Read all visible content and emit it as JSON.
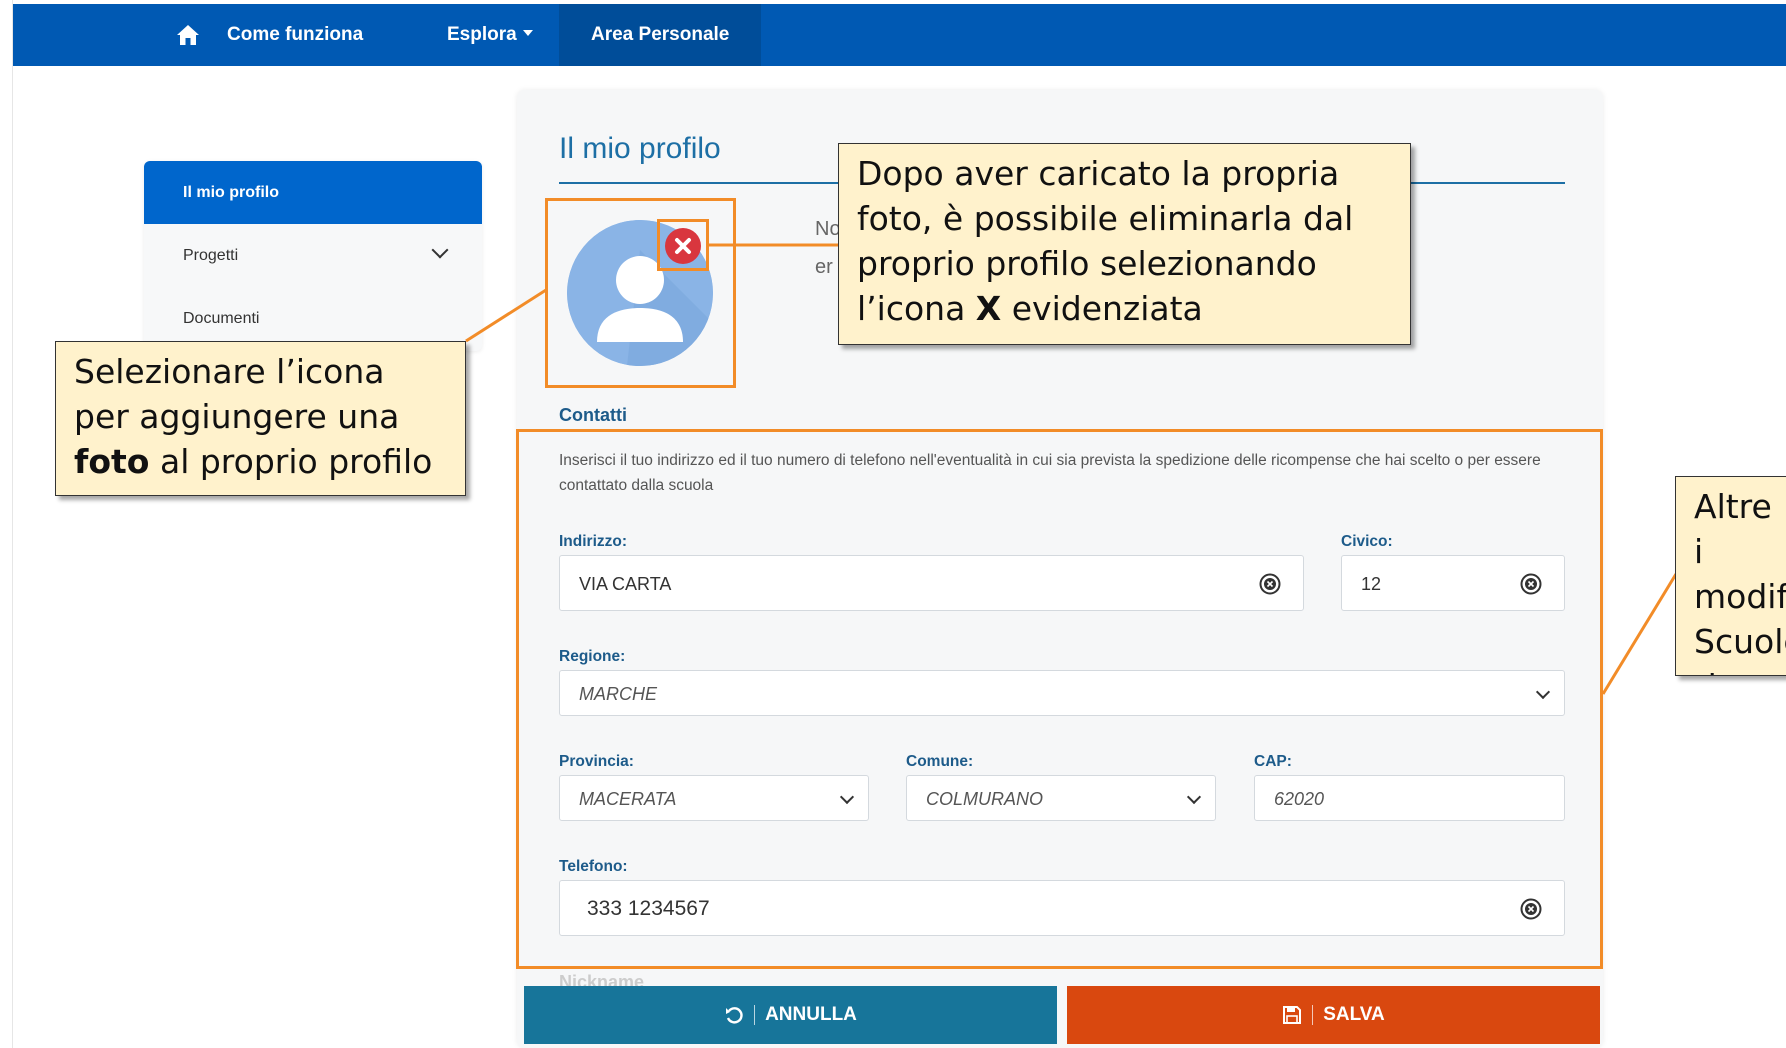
{
  "navbar": {
    "home_icon": "home-icon",
    "items": [
      {
        "label": "Come funziona"
      },
      {
        "label": "Esplora",
        "has_dropdown": true
      },
      {
        "label": "Area Personale",
        "active": true
      }
    ],
    "color": "#0059b3"
  },
  "sidebar": {
    "items": [
      {
        "label": "Il mio profilo",
        "active": true
      },
      {
        "label": "Progetti",
        "icon": "chevron-down-icon"
      },
      {
        "label": "Documenti"
      }
    ]
  },
  "profile": {
    "title": "Il mio profilo",
    "avatar_icon": "user-avatar-icon",
    "remove_icon": "remove-photo-icon",
    "partial_text_1": "No",
    "partial_text_2": "er",
    "contacts": {
      "label": "Contatti",
      "description": "Inserisci il tuo indirizzo ed il tuo numero di telefono nell'eventualità in cui sia prevista la spedizione delle ricompense che hai scelto o per essere contattato dalla scuola"
    },
    "fields": {
      "indirizzo": {
        "label": "Indirizzo:",
        "value": "VIA CARTA"
      },
      "civico": {
        "label": "Civico:",
        "value": "12"
      },
      "regione": {
        "label": "Regione:",
        "value": "MARCHE"
      },
      "provincia": {
        "label": "Provincia:",
        "value": "MACERATA"
      },
      "comune": {
        "label": "Comune:",
        "value": "COLMURANO"
      },
      "cap": {
        "label": "CAP:",
        "value": "62020"
      },
      "telefono": {
        "label": "Telefono:",
        "value": "333 1234567"
      }
    },
    "nickname_label": "Nickname"
  },
  "buttons": {
    "annulla": "ANNULLA",
    "salva": "SALVA",
    "annulla_color": "#17759a",
    "salva_color": "#d9480f"
  },
  "callouts": {
    "photo_add": {
      "part1": "Selezionare l’icona per aggiungere una ",
      "bold": "foto",
      "part2": " al proprio profilo"
    },
    "photo_remove": {
      "part1": "Dopo aver caricato la propria foto, è possibile eliminarla dal proprio profilo selezionando l’icona ",
      "bold": "X",
      "part2": " evidenziata"
    },
    "other_info": {
      "text": "Altre i modif Scuole ricomp"
    }
  },
  "highlight_color": "#f28c28",
  "callout_bg": "#fff2cc"
}
